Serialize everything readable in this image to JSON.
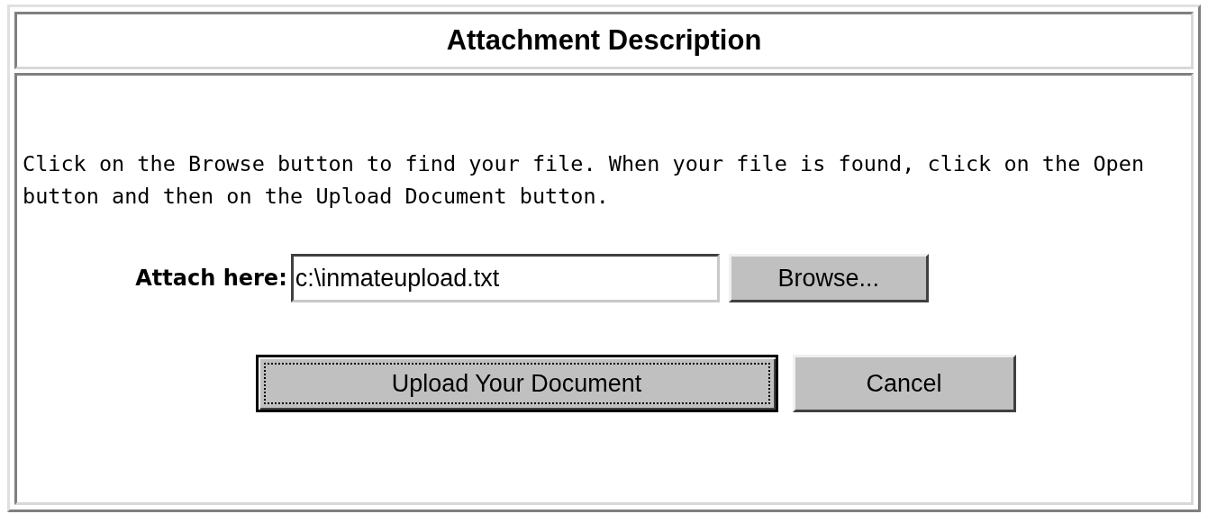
{
  "title": "Attachment Description",
  "instructions": "Click on the Browse button to find your file. When your file is found, click on the Open button and then on the Upload Document button.",
  "attach": {
    "label": "Attach here:",
    "value": "c:\\inmateupload.txt",
    "browse_button": "Browse..."
  },
  "buttons": [
    {
      "label": "Upload Your Document",
      "focused": true
    },
    {
      "label": "Cancel",
      "focused": false
    }
  ]
}
